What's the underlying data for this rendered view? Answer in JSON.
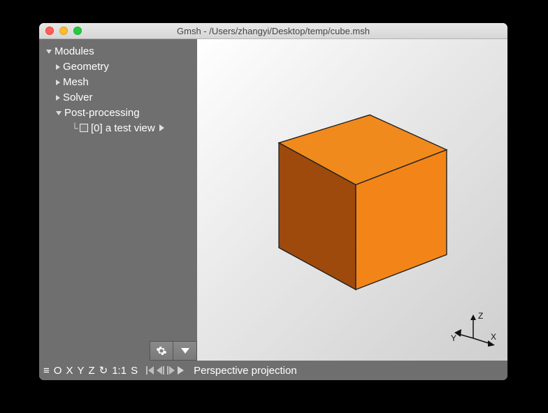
{
  "window": {
    "title": "Gmsh - /Users/zhangyi/Desktop/temp/cube.msh"
  },
  "sidebar": {
    "root": "Modules",
    "items": [
      {
        "label": "Geometry"
      },
      {
        "label": "Mesh"
      },
      {
        "label": "Solver"
      },
      {
        "label": "Post-processing",
        "expanded": true,
        "children": [
          {
            "label": "[0] a test view",
            "checked": false
          }
        ]
      }
    ]
  },
  "viewport": {
    "object_color": "#f38418",
    "face_dark": "#9e4a0d",
    "face_top": "#f18a1d",
    "axes": {
      "x": "X",
      "y": "Y",
      "z": "Z"
    }
  },
  "status": {
    "menu": "≡",
    "o": "O",
    "x": "X",
    "y": "Y",
    "z": "Z",
    "scale": "1:1",
    "s": "S",
    "mode": "Perspective projection"
  }
}
